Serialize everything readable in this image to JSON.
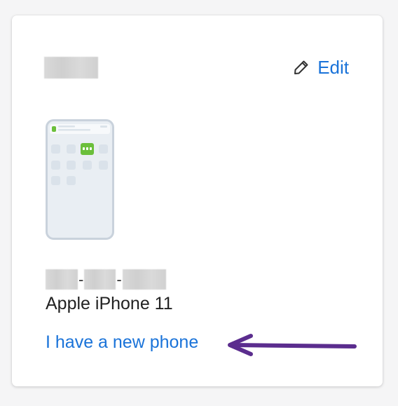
{
  "device_card": {
    "edit_label": "Edit",
    "model": "Apple iPhone 11",
    "new_phone_link": "I have a new phone",
    "number_separator": "-"
  },
  "colors": {
    "link": "#1a73d9",
    "arrow": "#5b2d8e",
    "duo_green": "#6bbf3b"
  },
  "icons": {
    "edit": "pencil-icon",
    "phone": "phone-illustration",
    "annotation": "arrow-annotation"
  }
}
